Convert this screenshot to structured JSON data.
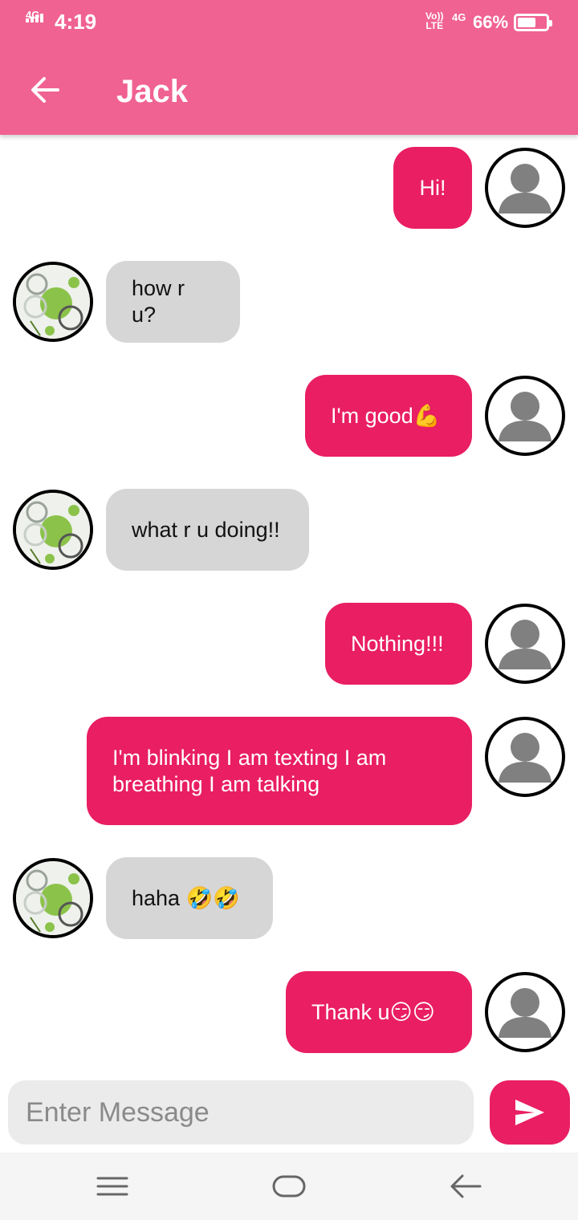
{
  "status_bar": {
    "network_left": "4G",
    "time": "4:19",
    "volte_top": "Vo))",
    "volte_bottom": "LTE",
    "network_right": "4G",
    "battery_percent": "66%",
    "battery_level": 0.66
  },
  "app_bar": {
    "title": "Jack",
    "color": "#f06292"
  },
  "messages": [
    {
      "sender": "me",
      "text": "Hi!"
    },
    {
      "sender": "Jack",
      "text": "how r u?"
    },
    {
      "sender": "me",
      "text": "I'm good💪"
    },
    {
      "sender": "Jack",
      "text": "what r u doing!!"
    },
    {
      "sender": "me",
      "text": "Nothing!!!"
    },
    {
      "sender": "me",
      "text": "I'm blinking I am texting I am breathing I am talking"
    },
    {
      "sender": "Jack",
      "text": "haha 🤣🤣"
    },
    {
      "sender": "me",
      "text": "Thank u😏😏"
    }
  ],
  "composer": {
    "placeholder": "Enter Message",
    "value": ""
  },
  "colors": {
    "sent_bubble": "#e91e63",
    "received_bubble": "#d6d6d6",
    "send_button": "#e91e63"
  },
  "icons": {
    "back": "arrow-left-icon",
    "send": "send-icon",
    "nav_menu": "menu-icon",
    "nav_home": "home-icon",
    "nav_back": "back-icon"
  }
}
